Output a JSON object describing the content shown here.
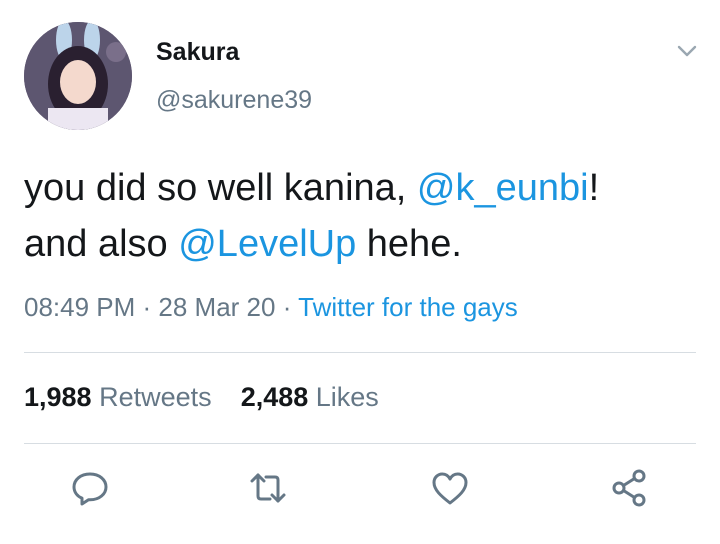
{
  "user": {
    "display_name": "Sakura",
    "handle": "@sakurene39"
  },
  "tweet": {
    "line1_prefix": "you did so well kanina, ",
    "mention1": "@k_eunbi",
    "line1_suffix": "!",
    "line2_prefix": "and also ",
    "mention2": "@LevelUp",
    "line2_suffix": " hehe."
  },
  "meta": {
    "time": "08:49 PM",
    "sep1": " · ",
    "date": "28 Mar 20",
    "sep2": " · ",
    "source": "Twitter for the gays"
  },
  "stats": {
    "retweets_count": "1,988",
    "retweets_label": "Retweets",
    "likes_count": "2,488",
    "likes_label": "Likes"
  },
  "icons": {
    "reply": "reply-icon",
    "retweet": "retweet-icon",
    "like": "heart-icon",
    "share": "share-icon",
    "menu": "chevron-down-icon"
  },
  "colors": {
    "link": "#1b95e0",
    "secondary": "#657786",
    "text": "#14171a",
    "divider": "#d7dde2"
  }
}
